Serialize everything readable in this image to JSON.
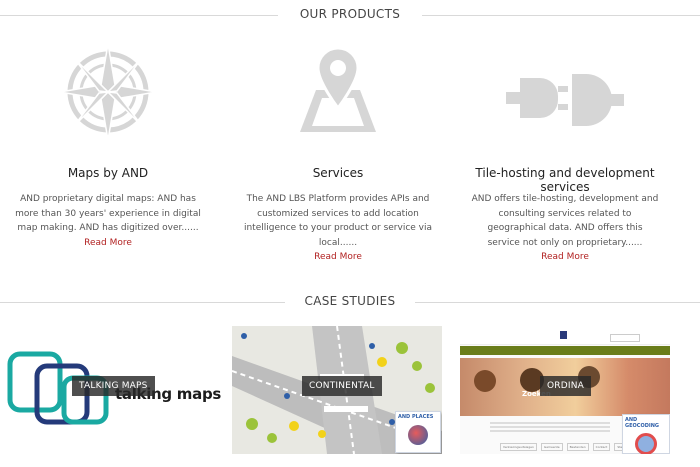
{
  "products_section": {
    "title": "OUR PRODUCTS"
  },
  "products": [
    {
      "title": "Maps by AND",
      "description": "AND proprietary digital maps: AND has more than 30 years' experience in digital map making.  AND has digitized over......",
      "read_more": "Read More",
      "icon": "compass-rose-icon"
    },
    {
      "title": "Services",
      "description": "The AND LBS Platform provides APIs and customized services to add location intelligence to your product or service via local......",
      "read_more": "Read More",
      "icon": "map-pin-icon"
    },
    {
      "title": "Tile-hosting and development services",
      "description": "AND offers tile-hosting, development and consulting services related to geographical data.  AND offers this service not only on proprietary......",
      "read_more": "Read More",
      "icon": "plug-icon"
    }
  ],
  "case_section": {
    "title": "CASE STUDIES"
  },
  "cases": [
    {
      "label": "TALKING MAPS",
      "logo_text": "talking maps"
    },
    {
      "label": "CONTINENTAL",
      "product_box": "AND PLACES"
    },
    {
      "label": "ORDINA",
      "product_box": "AND GEOCODING",
      "screenshot_text": "Zoeken",
      "buttons": [
        "Verkiezingsuitslagen",
        "Gemeente",
        "Bestanden",
        "Contact",
        "Stembureaus"
      ]
    }
  ],
  "colors": {
    "icon_gray": "#d6d6d6",
    "read_more": "#b22222",
    "label_bg": "#2a2a2a",
    "teal": "#1aa9a2",
    "navy": "#243a7a",
    "site_green": "#6a7d1a"
  }
}
